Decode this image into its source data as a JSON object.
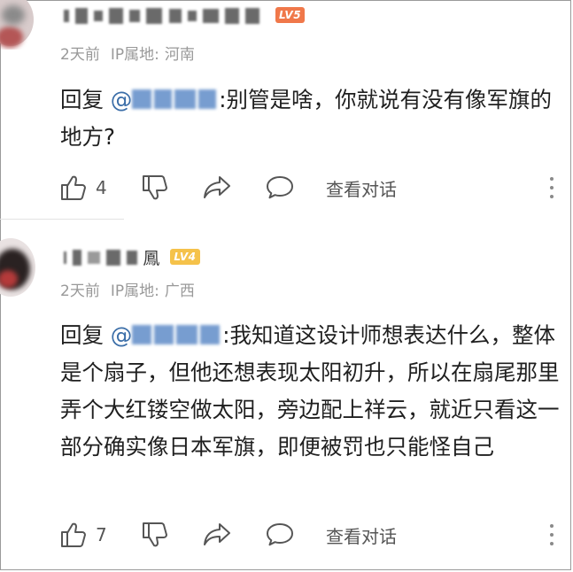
{
  "comments": [
    {
      "username_suffix": "",
      "level": "LV5",
      "time": "2天前",
      "ip_label": "IP属地:",
      "location": "河南",
      "reply_prefix": "回复",
      "mention_at": "@",
      "body": ":别管是啥，你就说有没有像军旗的地方?",
      "like_count": "4",
      "view_conversation": "查看对话"
    },
    {
      "username_suffix": "鳳",
      "level": "LV4",
      "time": "2天前",
      "ip_label": "IP属地:",
      "location": "广西",
      "reply_prefix": "回复",
      "mention_at": "@",
      "body": ":我知道这设计师想表达什么，整体是个扇子，但他还想表现太阳初升，所以在扇尾那里弄个大红镂空做太阳，旁边配上祥云，就近只看这一部分确实像日本军旗，即便被罚也只能怪自己",
      "like_count": "7",
      "view_conversation": "查看对话"
    }
  ],
  "icons": {
    "like": "thumbs-up-icon",
    "dislike": "thumbs-down-icon",
    "share": "share-arrow-icon",
    "comment": "comment-bubble-icon",
    "more": "more-vertical-icon"
  },
  "colors": {
    "lv5": "#f0784a",
    "lv4": "#f5c24a",
    "mention": "#3b6ea8",
    "meta": "#999999"
  }
}
